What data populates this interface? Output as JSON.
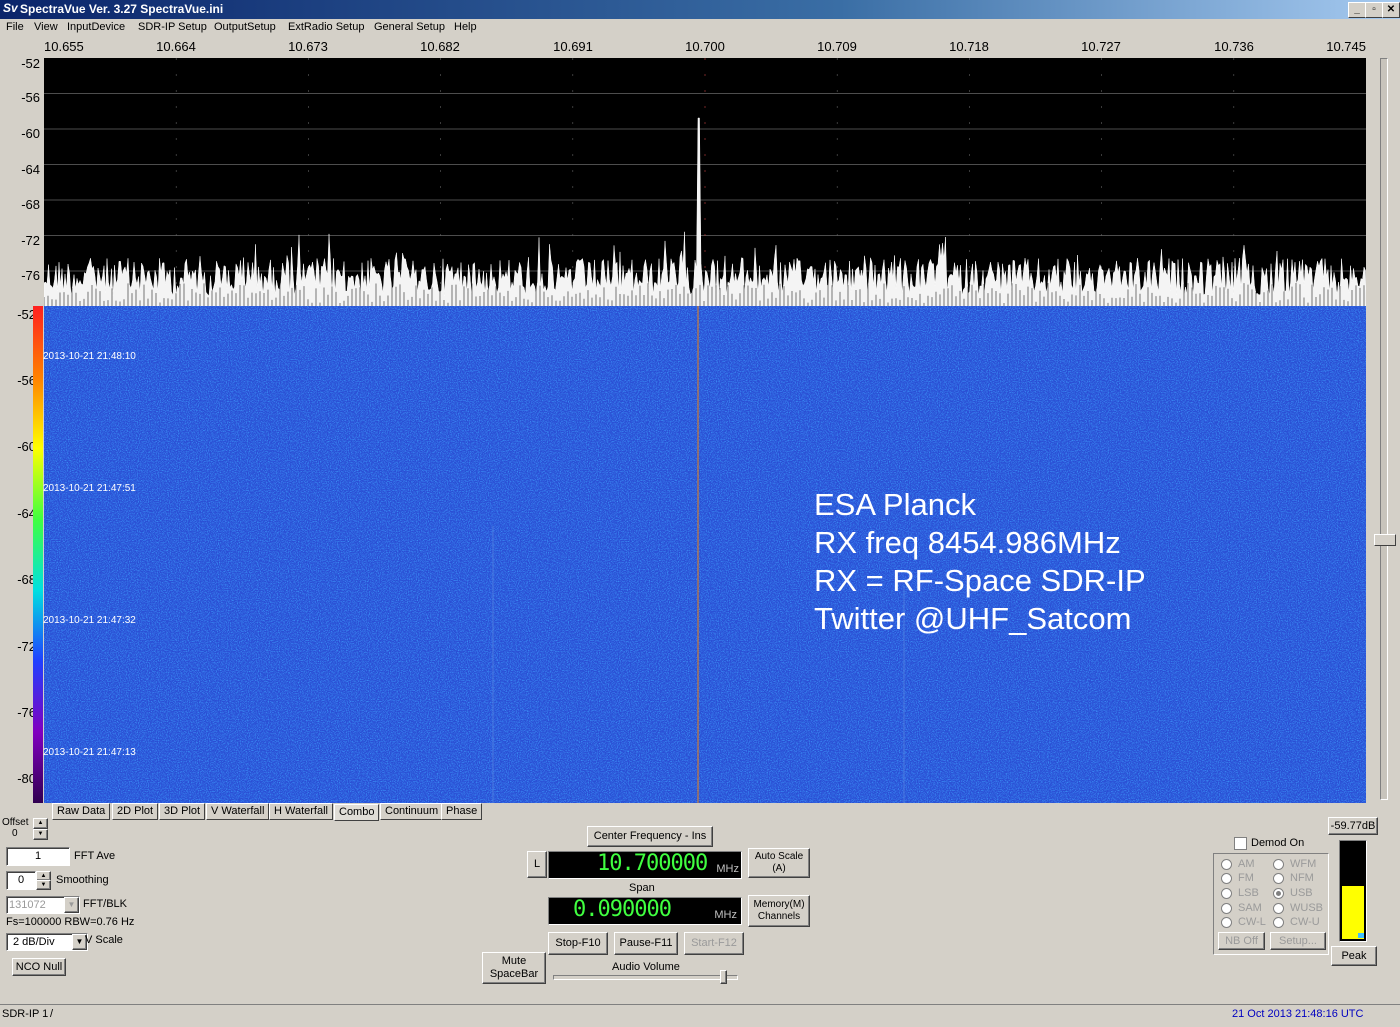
{
  "window": {
    "logo": "Sv",
    "title": "SpectraVue Ver. 3.27  SpectraVue.ini",
    "min": "_",
    "max": "▫",
    "close": "✕"
  },
  "menu": [
    "File",
    "View",
    "InputDevice",
    "SDR-IP Setup",
    "OutputSetup",
    "ExtRadio Setup",
    "General Setup",
    "Help"
  ],
  "freq_axis": [
    "10.655",
    "10.664",
    "10.673",
    "10.682",
    "10.691",
    "10.700",
    "10.709",
    "10.718",
    "10.727",
    "10.736",
    "10.745"
  ],
  "spectrum_y": [
    "-52",
    "-56",
    "-60",
    "-64",
    "-68",
    "-72",
    "-76"
  ],
  "waterfall_y": [
    "-52",
    "-56",
    "-60",
    "-64",
    "-68",
    "-72",
    "-76",
    "-80"
  ],
  "waterfall_times": [
    "2013-10-21 21:48:10",
    "2013-10-21 21:47:51",
    "2013-10-21 21:47:32",
    "2013-10-21 21:47:13"
  ],
  "annotation": [
    "ESA Planck",
    "RX freq 8454.986MHz",
    "RX = RF-Space SDR-IP",
    "Twitter @UHF_Satcom"
  ],
  "tabs": [
    "Raw Data",
    "2D Plot",
    "3D Plot",
    "V Waterfall",
    "H Waterfall",
    "Combo",
    "Continuum",
    "Phase"
  ],
  "left_panel": {
    "offset_label": "Offset",
    "offset_value": "0",
    "fft_ave_value": "1",
    "fft_ave_label": "FFT Ave",
    "smoothing_value": "0",
    "smoothing_label": "Smoothing",
    "fft_blk_value": "131072",
    "fft_blk_label": "FFT/BLK",
    "fs_info": "Fs=100000 RBW=0.76 Hz",
    "vscale_value": "2 dB/Div",
    "vscale_label": "V Scale",
    "nco_null": "NCO Null"
  },
  "center_panel": {
    "center_freq_btn": "Center Frequency - Ins",
    "l_btn": "L",
    "center_freq": "10.700000",
    "freq_unit": "MHz",
    "auto_scale": "Auto Scale (A)",
    "span_label": "Span",
    "span": "0.090000",
    "span_unit": "MHz",
    "memory": "Memory(M) Channels",
    "stop": "Stop-F10",
    "pause": "Pause-F11",
    "start": "Start-F12",
    "mute": "Mute SpaceBar",
    "audio_volume": "Audio Volume"
  },
  "demod": {
    "demod_on": "Demod On",
    "modes_left": [
      "AM",
      "FM",
      "LSB",
      "SAM",
      "CW-L"
    ],
    "modes_right": [
      "WFM",
      "NFM",
      "USB",
      "WUSB",
      "CW-U"
    ],
    "selected": "USB",
    "nb_off": "NB Off",
    "setup": "Setup..."
  },
  "meter": {
    "db": "-59.77dB",
    "peak": "Peak",
    "level": 0.55
  },
  "status": {
    "left": "SDR-IP 1",
    "sep": "/",
    "right": "21 Oct 2013  21:48:16 UTC"
  }
}
